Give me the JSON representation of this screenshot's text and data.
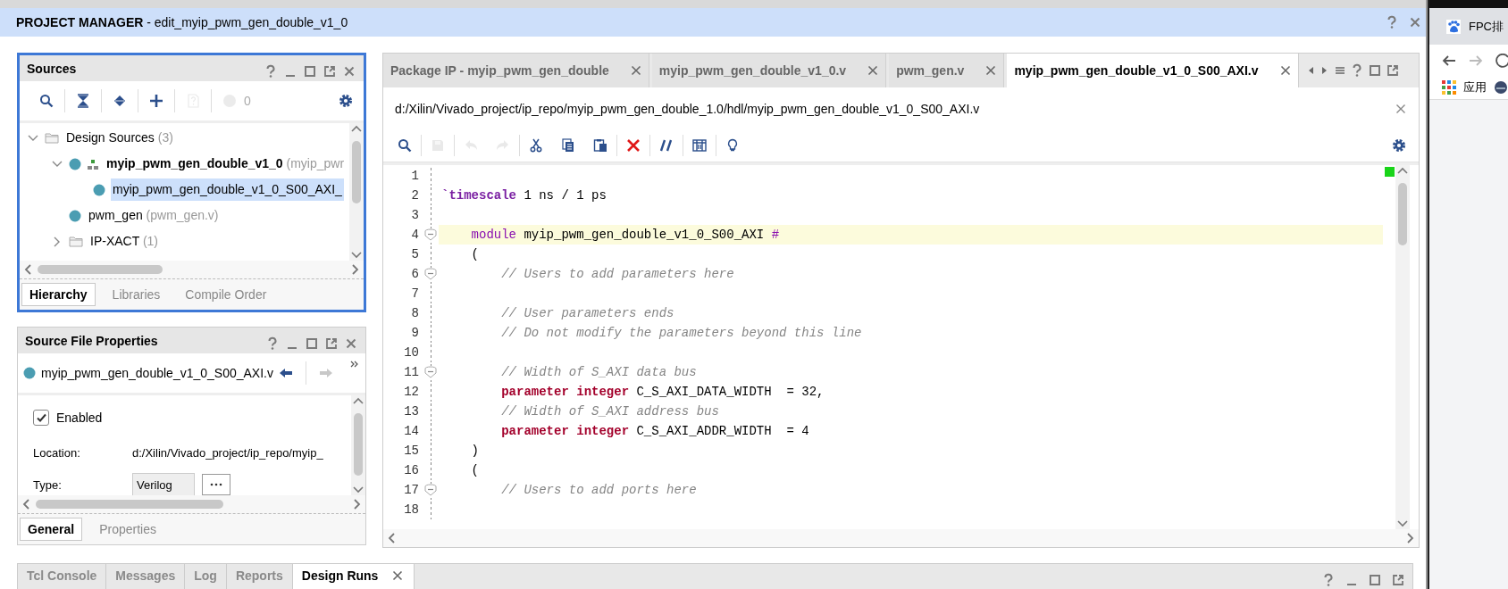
{
  "title_bar": {
    "title": "PROJECT MANAGER",
    "subtitle": "- edit_myip_pwm_gen_double_v1_0"
  },
  "sources": {
    "title": "Sources",
    "focused": true,
    "toolbar": [
      {
        "kind": "search",
        "disabled": false
      },
      {
        "kind": "collapse",
        "disabled": false
      },
      {
        "kind": "expand",
        "disabled": false
      },
      {
        "kind": "add",
        "disabled": false
      },
      {
        "kind": "doc-help",
        "disabled": true
      },
      {
        "kind": "status",
        "disabled": true
      }
    ],
    "status_count": "0",
    "tree": [
      {
        "label": "Design Sources",
        "detail": "(3)",
        "kind": "folder",
        "expanded": true,
        "selected": false,
        "children": [
          {
            "label": "myip_pwm_gen_double_v1_0",
            "detail": "(myip_pwr",
            "kind": "top",
            "expanded": true,
            "selected": false,
            "children": [
              {
                "label": "myip_pwm_gen_double_v1_0_S00_AXI_",
                "kind": "file",
                "selected": true
              }
            ]
          },
          {
            "label": "pwm_gen",
            "detail": "(pwm_gen.v)",
            "kind": "file",
            "selected": false
          },
          {
            "label": "IP-XACT",
            "detail": "(1)",
            "kind": "folder",
            "expanded": false,
            "selected": false
          }
        ]
      }
    ],
    "tabs": [
      {
        "label": "Hierarchy",
        "selected": true
      },
      {
        "label": "Libraries",
        "selected": false
      },
      {
        "label": "Compile Order",
        "selected": false
      }
    ]
  },
  "source_file_properties": {
    "title": "Source File Properties",
    "focused": false,
    "file": "myip_pwm_gen_double_v1_0_S00_AXI.v",
    "enabled": {
      "label": "Enabled",
      "checked": true
    },
    "fields": [
      {
        "label": "Location:",
        "value": "d:/Xilin/Vivado_project/ip_repo/myip_",
        "kind": "text"
      },
      {
        "label": "Type:",
        "value": "Verilog",
        "kind": "combo"
      }
    ],
    "tabs": [
      {
        "label": "General",
        "selected": true
      },
      {
        "label": "Properties",
        "selected": false
      }
    ]
  },
  "editor": {
    "tabs": [
      {
        "label": "Package IP - myip_pwm_gen_double",
        "selected": false
      },
      {
        "label": "myip_pwm_gen_double_v1_0.v",
        "selected": false
      },
      {
        "label": "pwm_gen.v",
        "selected": false
      },
      {
        "label": "myip_pwm_gen_double_v1_0_S00_AXI.v",
        "selected": true
      }
    ],
    "path": "d:/Xilin/Vivado_project/ip_repo/myip_pwm_gen_double_1.0/hdl/myip_pwm_gen_double_v1_0_S00_AXI.v",
    "toolbar": [
      {
        "kind": "search",
        "disabled": false
      },
      {
        "kind": "save",
        "disabled": true
      },
      {
        "kind": "undo",
        "disabled": true
      },
      {
        "kind": "redo",
        "disabled": true
      },
      {
        "kind": "cut",
        "disabled": false
      },
      {
        "kind": "copy",
        "disabled": false
      },
      {
        "kind": "paste",
        "disabled": false
      },
      {
        "kind": "delete",
        "disabled": false
      },
      {
        "kind": "comment",
        "disabled": false
      },
      {
        "kind": "columns",
        "disabled": false
      },
      {
        "kind": "hint",
        "disabled": false
      }
    ],
    "lines": [
      {
        "number": "1",
        "fold": false,
        "current": false
      },
      {
        "number": "2",
        "fold": false,
        "current": false,
        "tokens": [
          {
            "text": "`timescale",
            "kind": "directive"
          },
          {
            "text": " 1 ns / 1 ps",
            "kind": "plain"
          }
        ]
      },
      {
        "number": "3",
        "fold": false,
        "current": false
      },
      {
        "number": "4",
        "fold": true,
        "current": true,
        "tokens": [
          {
            "text": "    module",
            "kind": "keyword"
          },
          {
            "text": " myip_pwm_gen_double_v1_0_S00_AXI ",
            "kind": "plain"
          },
          {
            "text": "#",
            "kind": "operator"
          }
        ]
      },
      {
        "number": "5",
        "fold": false,
        "current": false,
        "tokens": [
          {
            "text": "    (",
            "kind": "plain"
          }
        ]
      },
      {
        "number": "6",
        "fold": true,
        "current": false,
        "tokens": [
          {
            "text": "        // Users to add parameters here",
            "kind": "comment"
          }
        ]
      },
      {
        "number": "7",
        "fold": false,
        "current": false
      },
      {
        "number": "8",
        "fold": false,
        "current": false,
        "tokens": [
          {
            "text": "        // User parameters ends",
            "kind": "comment"
          }
        ]
      },
      {
        "number": "9",
        "fold": false,
        "current": false,
        "tokens": [
          {
            "text": "        // Do not modify the parameters beyond this line",
            "kind": "comment"
          }
        ]
      },
      {
        "number": "10",
        "fold": false,
        "current": false
      },
      {
        "number": "11",
        "fold": true,
        "current": false,
        "tokens": [
          {
            "text": "        // Width of S_AXI data bus",
            "kind": "comment"
          }
        ]
      },
      {
        "number": "12",
        "fold": false,
        "current": false,
        "tokens": [
          {
            "text": "        parameter integer",
            "kind": "type_keyword"
          },
          {
            "text": " C_S_AXI_DATA_WIDTH  = 32,",
            "kind": "plain"
          }
        ]
      },
      {
        "number": "13",
        "fold": false,
        "current": false,
        "tokens": [
          {
            "text": "        // Width of S_AXI address bus",
            "kind": "comment"
          }
        ]
      },
      {
        "number": "14",
        "fold": false,
        "current": false,
        "tokens": [
          {
            "text": "        parameter integer",
            "kind": "type_keyword"
          },
          {
            "text": " C_S_AXI_ADDR_WIDTH  = 4",
            "kind": "plain"
          }
        ]
      },
      {
        "number": "15",
        "fold": false,
        "current": false,
        "tokens": [
          {
            "text": "    )",
            "kind": "plain"
          }
        ]
      },
      {
        "number": "16",
        "fold": false,
        "current": false,
        "tokens": [
          {
            "text": "    (",
            "kind": "plain"
          }
        ]
      },
      {
        "number": "17",
        "fold": true,
        "current": false,
        "tokens": [
          {
            "text": "        // Users to add ports here",
            "kind": "comment"
          }
        ]
      },
      {
        "number": "18",
        "fold": false,
        "current": false
      }
    ]
  },
  "bottom_tabs": [
    {
      "label": "Tcl Console",
      "selected": false
    },
    {
      "label": "Messages",
      "selected": false
    },
    {
      "label": "Log",
      "selected": false
    },
    {
      "label": "Reports",
      "selected": false
    },
    {
      "label": "Design Runs",
      "selected": true
    }
  ],
  "browser": {
    "tab_title": "FPC排",
    "bookmark": "应用"
  }
}
